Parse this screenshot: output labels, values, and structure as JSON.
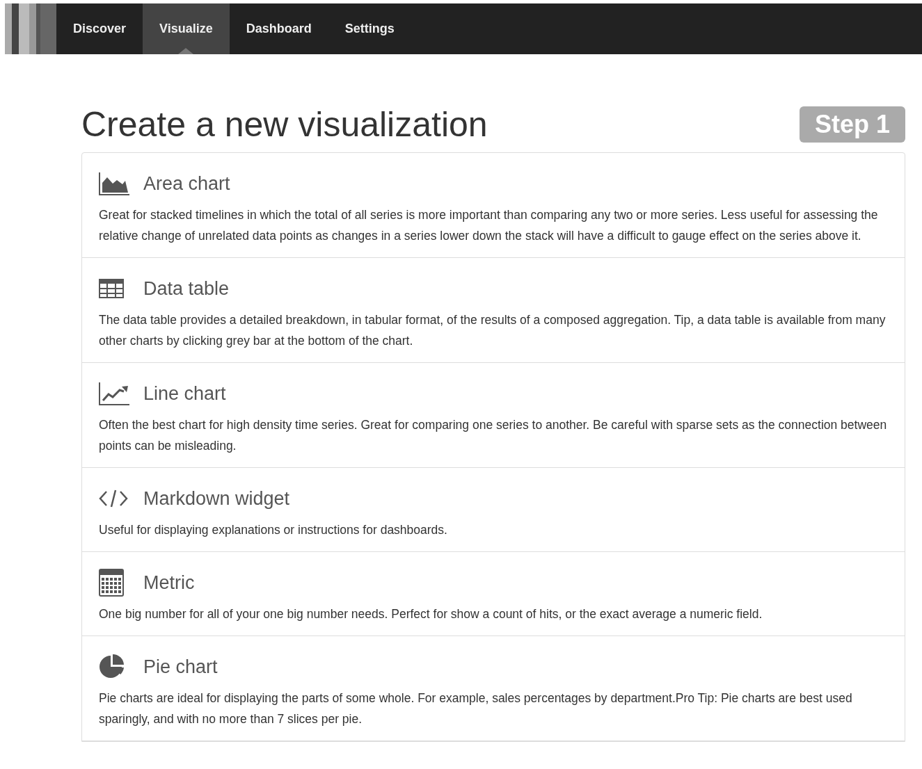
{
  "nav": {
    "tabs": [
      {
        "label": "Discover",
        "selected": false
      },
      {
        "label": "Visualize",
        "selected": true
      },
      {
        "label": "Dashboard",
        "selected": false
      },
      {
        "label": "Settings",
        "selected": false
      }
    ]
  },
  "heading": "Create a new visualization",
  "step_badge": "Step 1",
  "visualization_types": [
    {
      "kind": "area",
      "title": "Area chart",
      "description": "Great for stacked timelines in which the total of all series is more important than comparing any two or more series. Less useful for assessing the relative change of unrelated data points as changes in a series lower down the stack will have a difficult to gauge effect on the series above it."
    },
    {
      "kind": "table",
      "title": "Data table",
      "description": "The data table provides a detailed breakdown, in tabular format, of the results of a composed aggregation. Tip, a data table is available from many other charts by clicking grey bar at the bottom of the chart."
    },
    {
      "kind": "line",
      "title": "Line chart",
      "description": "Often the best chart for high density time series. Great for comparing one series to another. Be careful with sparse sets as the connection between points can be misleading."
    },
    {
      "kind": "code",
      "title": "Markdown widget",
      "description": "Useful for displaying explanations or instructions for dashboards."
    },
    {
      "kind": "metric",
      "title": "Metric",
      "description": "One big number for all of your one big number needs. Perfect for show a count of hits, or the exact average a numeric field."
    },
    {
      "kind": "pie",
      "title": "Pie chart",
      "description": "Pie charts are ideal for displaying the parts of some whole. For example, sales percentages by department.Pro Tip: Pie charts are best used sparingly, and with no more than 7 slices per pie."
    }
  ]
}
